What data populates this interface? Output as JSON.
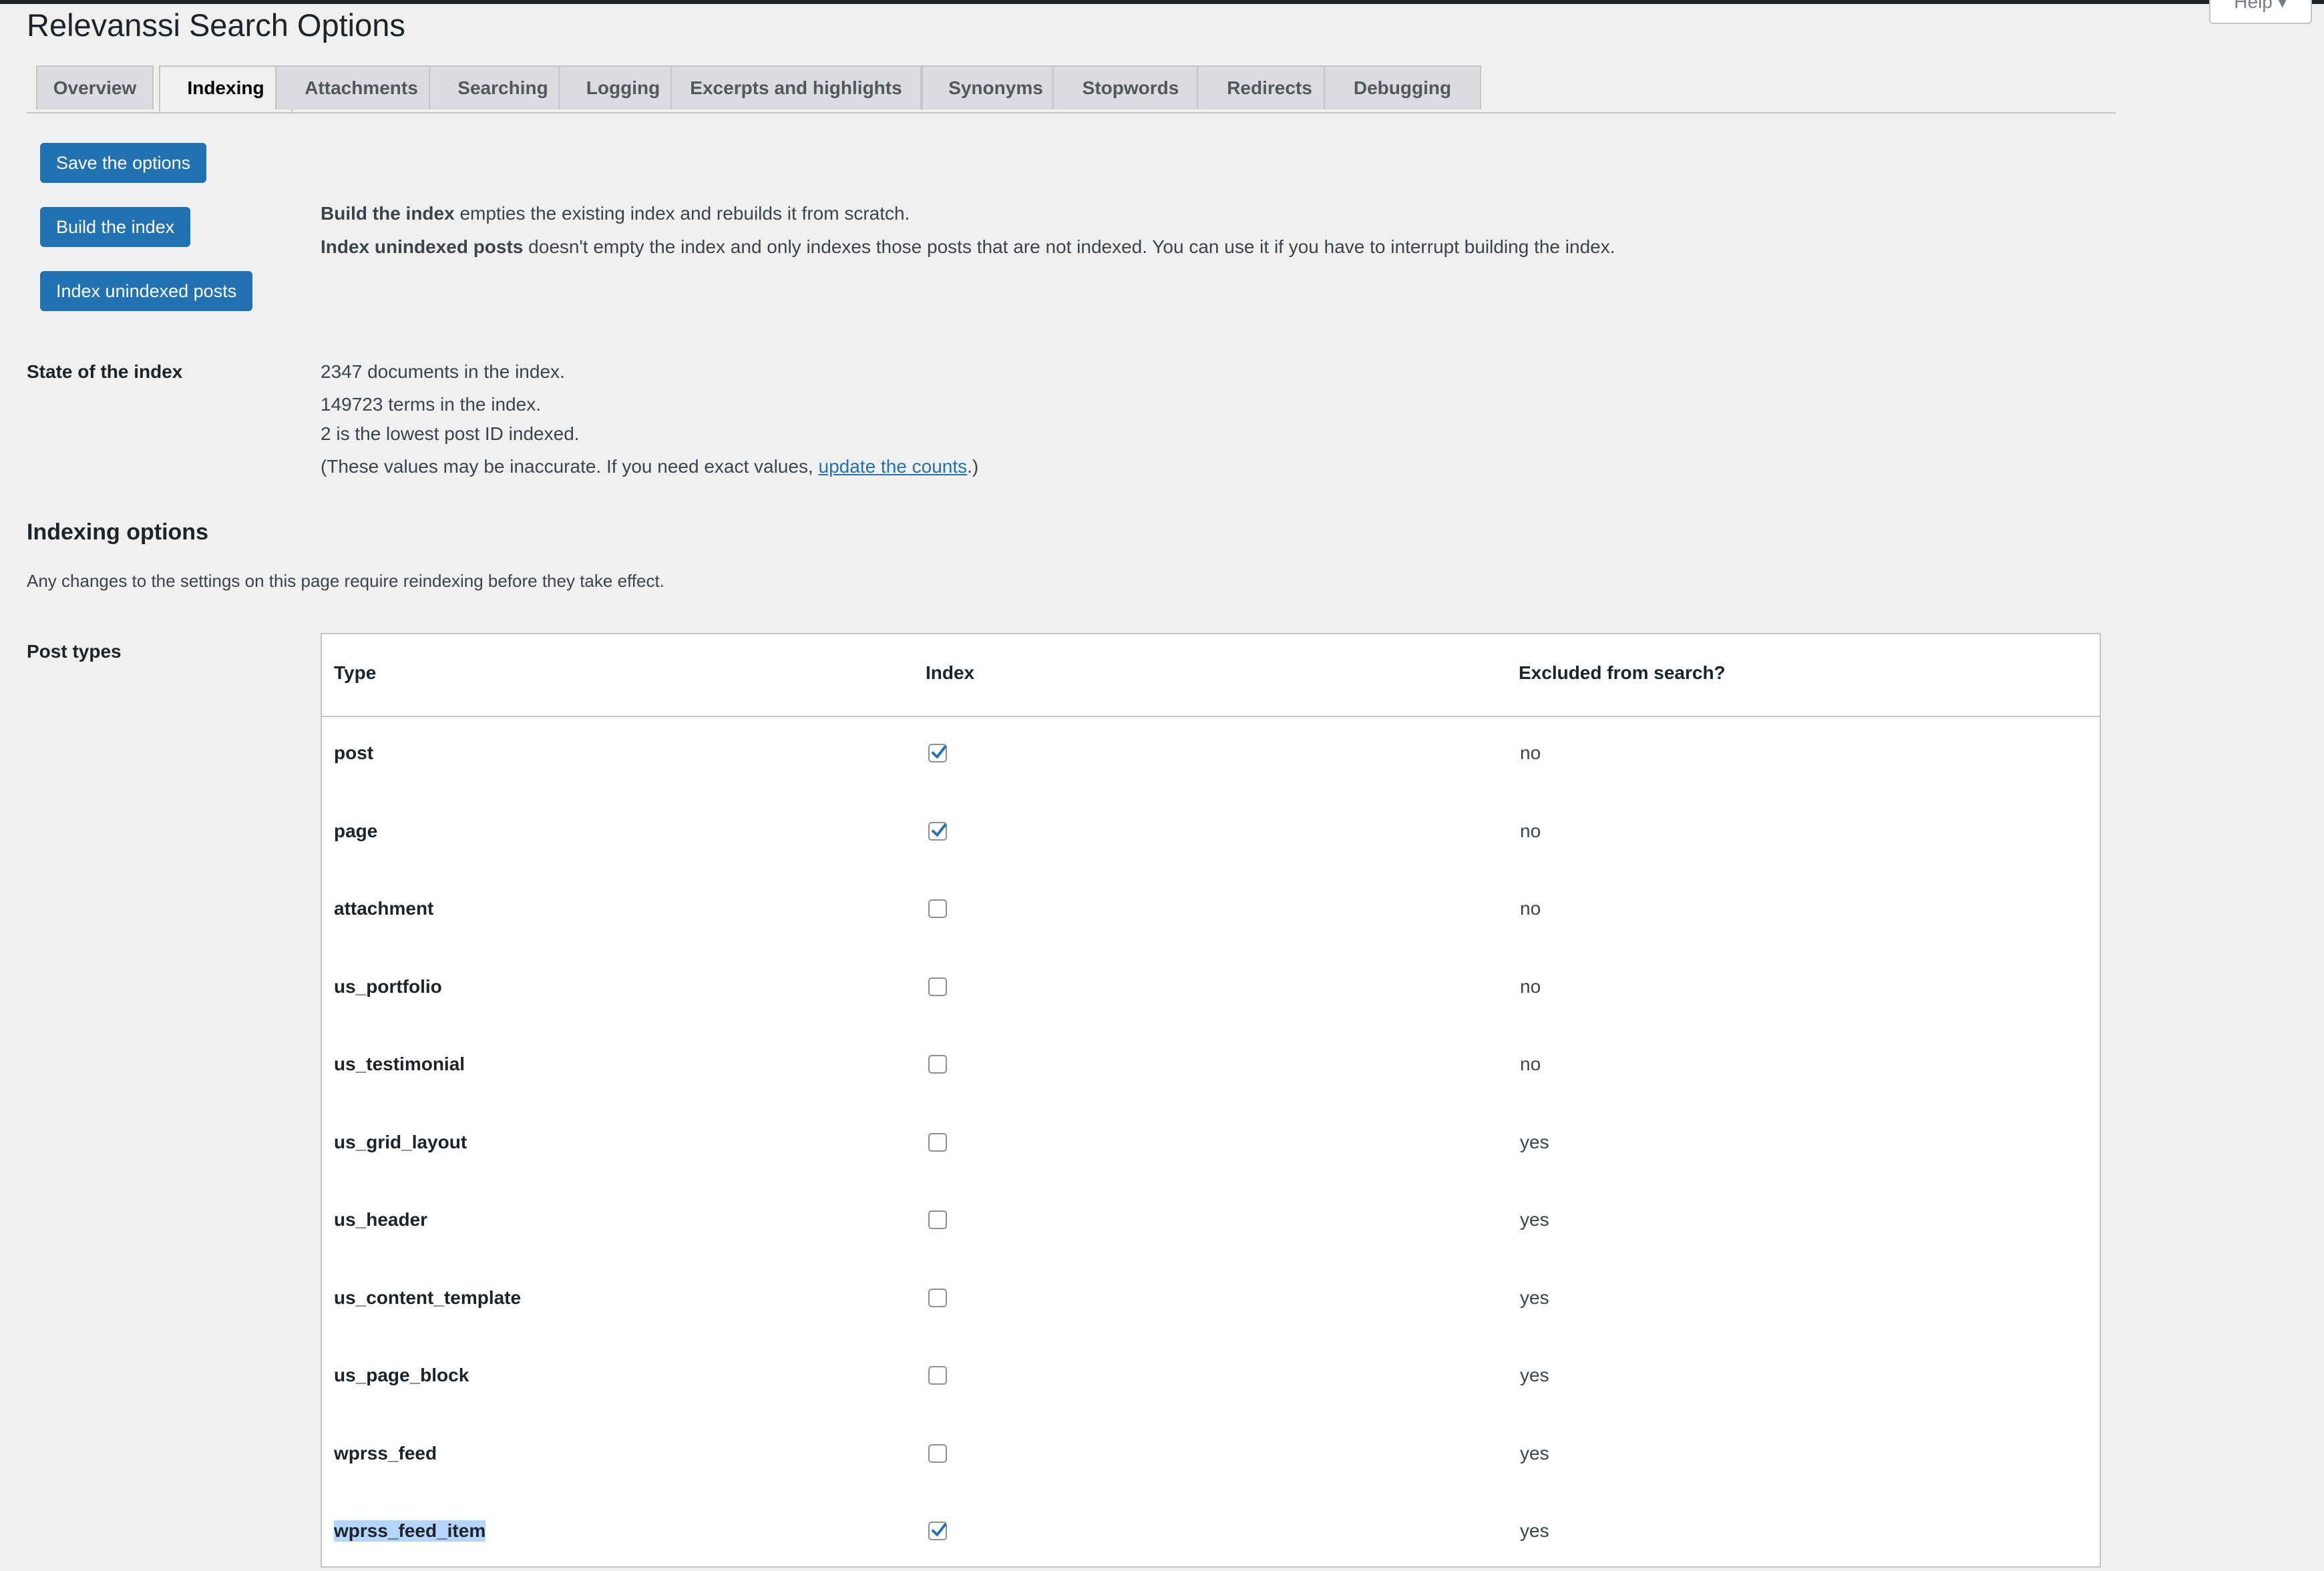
{
  "page": {
    "title": "Relevanssi Search Options",
    "help_label": "Help ▾"
  },
  "tabs": [
    {
      "label": "Overview"
    },
    {
      "label": "Indexing"
    },
    {
      "label": "Attachments"
    },
    {
      "label": "Searching"
    },
    {
      "label": "Logging"
    },
    {
      "label": "Excerpts and highlights"
    },
    {
      "label": "Synonyms"
    },
    {
      "label": "Stopwords"
    },
    {
      "label": "Redirects"
    },
    {
      "label": "Debugging"
    }
  ],
  "active_tab": "Indexing",
  "buttons": {
    "save": "Save the options",
    "build": "Build the index",
    "index_unindexed": "Index unindexed posts"
  },
  "build_desc": {
    "bold": "Build the index",
    "rest": " empties the existing index and rebuilds it from scratch."
  },
  "unindexed_desc": {
    "bold": "Index unindexed posts",
    "rest": " doesn't empty the index and only indexes those posts that are not indexed. You can use it if you have to interrupt building the index."
  },
  "state": {
    "label": "State of the index",
    "documents": "2347 documents in the index.",
    "terms": "149723 terms in the index.",
    "lowest_id": "2 is the lowest post ID indexed.",
    "note_prefix": "(These values may be inaccurate. If you need exact values, ",
    "note_link": "update the counts",
    "note_suffix": ".)"
  },
  "indexing_options": {
    "title": "Indexing options",
    "note": "Any changes to the settings on this page require reindexing before they take effect."
  },
  "post_types": {
    "label": "Post types",
    "headers": {
      "type": "Type",
      "index": "Index",
      "excluded": "Excluded from search?"
    },
    "rows": [
      {
        "type": "post",
        "indexed": true,
        "excluded": "no"
      },
      {
        "type": "page",
        "indexed": true,
        "excluded": "no"
      },
      {
        "type": "attachment",
        "indexed": false,
        "excluded": "no"
      },
      {
        "type": "us_portfolio",
        "indexed": false,
        "excluded": "no"
      },
      {
        "type": "us_testimonial",
        "indexed": false,
        "excluded": "no"
      },
      {
        "type": "us_grid_layout",
        "indexed": false,
        "excluded": "yes"
      },
      {
        "type": "us_header",
        "indexed": false,
        "excluded": "yes"
      },
      {
        "type": "us_content_template",
        "indexed": false,
        "excluded": "yes"
      },
      {
        "type": "us_page_block",
        "indexed": false,
        "excluded": "yes"
      },
      {
        "type": "wprss_feed",
        "indexed": false,
        "excluded": "yes"
      },
      {
        "type": "wprss_feed_item",
        "indexed": true,
        "excluded": "yes",
        "selected_text": true
      }
    ]
  },
  "colors": {
    "accent": "#2271b1",
    "background": "#f0f0f1",
    "selection": "#b4d5fe"
  }
}
